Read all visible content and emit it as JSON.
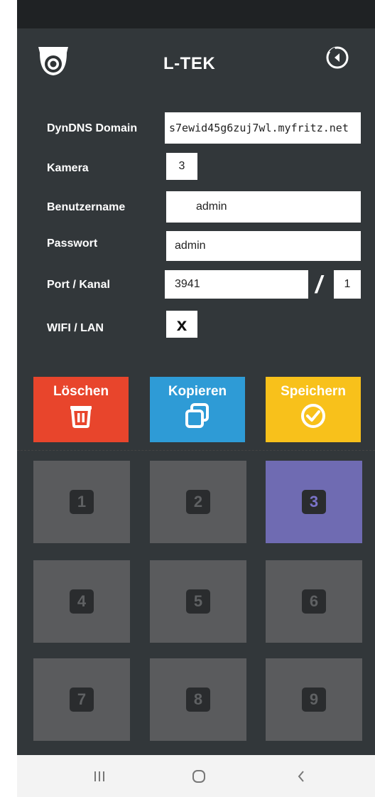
{
  "header": {
    "brand": "L-TEK",
    "icons": {
      "logo": "security-camera-icon",
      "back": "back-icon"
    }
  },
  "form": {
    "dyndns": {
      "label": "DynDNS Domain",
      "value": "s7ewid45g6zuj7wl.myfritz.net"
    },
    "camera": {
      "label": "Kamera",
      "value": "3"
    },
    "username": {
      "label": "Benutzername",
      "value": "admin"
    },
    "password": {
      "label": "Passwort",
      "value": "admin"
    },
    "port": {
      "label": "Port / Kanal",
      "value": "3941",
      "separator": "/",
      "channel": "1"
    },
    "wifi": {
      "label": "WIFI / LAN",
      "value": "x"
    }
  },
  "actions": {
    "delete": {
      "label": "Löschen",
      "color": "#e8452c",
      "icon": "trash-icon"
    },
    "copy": {
      "label": "Kopieren",
      "color": "#2e9bd6",
      "icon": "copy-icon"
    },
    "save": {
      "label": "Speichern",
      "color": "#f8c11b",
      "icon": "check-circle-icon"
    }
  },
  "cameras": {
    "selected": 3,
    "tiles": [
      "1",
      "2",
      "3",
      "4",
      "5",
      "6",
      "7",
      "8",
      "9"
    ],
    "active_color": "#6f6bb2"
  },
  "system_nav": {
    "recent": "recent-apps-icon",
    "home": "home-icon",
    "back": "back-arrow-icon"
  }
}
